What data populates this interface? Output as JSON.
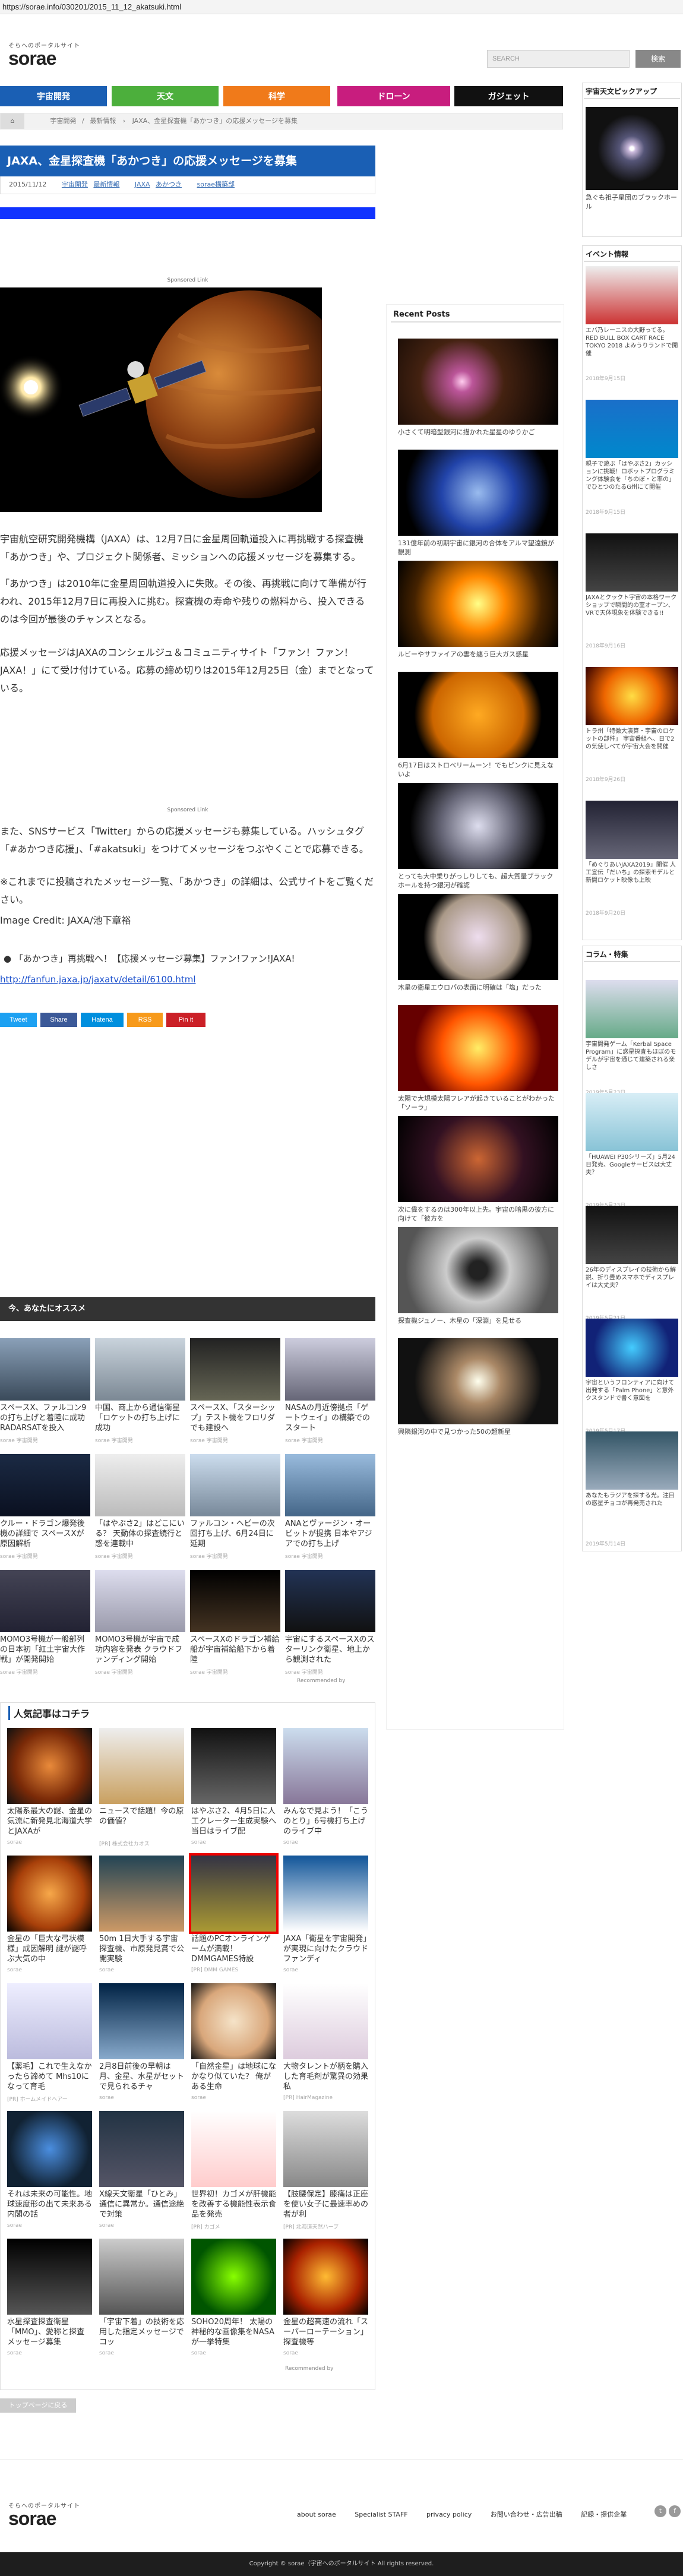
{
  "browser": {
    "url": "https://sorae.info/030201/2015_11_12_akatsuki.html"
  },
  "site": {
    "tagline": "そらへのポータルサイト",
    "logo": "sorae"
  },
  "search": {
    "placeholder": "SEARCH",
    "button": "検索"
  },
  "nav": [
    {
      "label": "宇宙開発",
      "color": "#1a5fb4"
    },
    {
      "label": "天文",
      "color": "#4caf3c"
    },
    {
      "label": "科学",
      "color": "#f07a1a"
    },
    {
      "label": "ドローン",
      "color": "#c81d7e"
    },
    {
      "label": "ガジェット",
      "color": "#111111"
    }
  ],
  "breadcrumb": {
    "items": [
      "宇宙開発",
      "最新情報",
      "JAXA、金星探査機「あかつき」の応援メッセージを募集"
    ]
  },
  "article": {
    "title": "JAXA、金星探査機「あかつき」の応援メッセージを募集",
    "date": "2015/11/12",
    "tags": [
      "宇宙開発",
      "最新情報",
      "JAXA",
      "あかつき",
      "sorae構築部"
    ],
    "sponsored1": "Sponsored Link",
    "p1": "宇宙航空研究開発機構（JAXA）は、12月7日に金星周回軌道投入に再挑戦する探査機「あかつき」や、プロジェクト関係者、ミッションへの応援メッセージを募集する。",
    "p2": "「あかつき」は2010年に金星周回軌道投入に失敗。その後、再挑戦に向けて準備が行われ、2015年12月7日に再投入に挑む。探査機の寿命や残りの燃料から、投入できるのは今回が最後のチャンスとなる。",
    "p3": "応援メッセージはJAXAのコンシェルジュ＆コミュニティサイト「ファン！ファン！JAXA！」にて受け付けている。応募の締め切りは2015年12月25日（金）までとなっている。",
    "sponsored2": "Sponsored Link",
    "p4": "また、SNSサービス「Twitter」からの応援メッセージも募集している。ハッシュタグ「#あかつき応援」、「#akatsuki」をつけてメッセージをつぶやくことで応募できる。",
    "p5": "※これまでに投稿されたメッセージ一覧、「あかつき」の詳細は、公式サイトをご覧ください。",
    "credit": "Image Credit: JAXA/池下章裕",
    "link_label": "「あかつき」再挑戦へ！【応援メッセージ募集】ファン!ファン!JAXA!",
    "link_url": "http://fanfun.jaxa.jp/jaxatv/detail/6100.html",
    "share": [
      {
        "label": "Tweet",
        "color": "#1da1f2"
      },
      {
        "label": "Share",
        "color": "#3b5998"
      },
      {
        "label": "Hatena",
        "color": "#008fde"
      },
      {
        "label": "RSS",
        "color": "#f79a1b"
      },
      {
        "label": "Pin it",
        "color": "#cb2027"
      }
    ]
  },
  "recommend": {
    "heading": "今、あなたにオススメ",
    "footer": "Recommended by",
    "items": [
      {
        "text": "スペースX、ファルコン9の打ち上げと着陸に成功 RADARSATを投入",
        "src": "sorae 宇宙開発"
      },
      {
        "text": "中国、商上から通信衛星「ロケットの打ち上げに成功",
        "src": "sorae 宇宙開発"
      },
      {
        "text": "スペースX、「スターシップ」テスト機をフロリダでも建設へ",
        "src": "sorae 宇宙開発"
      },
      {
        "text": "NASAの月近傍拠点「ゲートウェイ」の構築でのスタート",
        "src": "sorae 宇宙開発"
      },
      {
        "text": "クルー・ドラゴン爆発後機の詳細で スペースXが原因解析",
        "src": "sorae 宇宙開発"
      },
      {
        "text": "「はやぶさ2」はどこにいる？ 天動体の探査続行と惑を連載中",
        "src": "sorae 宇宙開発"
      },
      {
        "text": "ファルコン・ヘビーの次回打ち上げ、6月24日に延期",
        "src": "sorae 宇宙開発"
      },
      {
        "text": "ANAとヴァージン・オービットが提携 日本やアジアでの打ち上げ",
        "src": "sorae 宇宙開発"
      },
      {
        "text": "MOMO3号機が一般部列の日本初「紅土宇宙大作戦」が開発開始",
        "src": "sorae 宇宙開発"
      },
      {
        "text": "MOMO3号機が宇宙で成功内容を発表 クラウドファンディング開始",
        "src": "sorae 宇宙開発"
      },
      {
        "text": "スペースXのドラゴン補給船が宇宙補給船下から着陸",
        "src": "sorae 宇宙開発"
      },
      {
        "text": "宇宙にするスペースXのスターリンク衛星、地上から観測された",
        "src": "sorae 宇宙開発"
      }
    ]
  },
  "popular": {
    "heading": "人気記事はコチラ",
    "footer": "Recommended by",
    "items": [
      {
        "text": "太陽系最大の謎、金星の気流に新発見北海道大学とJAXAが",
        "src": "sorae"
      },
      {
        "text": "ニュースで話題！今の原の価値？",
        "src": "[PR] 株式会社カオス"
      },
      {
        "text": "はやぶさ2、4月5日に人工クレーター生成実験へ 当日はライブ配",
        "src": "sorae"
      },
      {
        "text": "みんなで見よう！「こうのとり」6号機打ち上げのライブ中",
        "src": "sorae"
      },
      {
        "text": "金星の「巨大な弓状模様」成因解明 謎が謎呼ぶ大気の中",
        "src": "sorae"
      },
      {
        "text": "50m 1日大手する宇宙探査機、市原発見賞で公開実験",
        "src": "sorae"
      },
      {
        "text": "話題のPCオンラインゲームが満載！DMMGAMES特設",
        "src": "[PR] DMM GAMES"
      },
      {
        "text": "JAXA「衛星を宇宙開発」が実現に向けたクラウドファンディ",
        "src": "sorae"
      },
      {
        "text": "【薬毛】これで生えなかったら諦めて Mhs10になって育毛",
        "src": "[PR] ホームメイドヘアー"
      },
      {
        "text": "2月8日前後の早朝は月、金星、水星がセットで見られるチャ",
        "src": "sorae"
      },
      {
        "text": "「自然金星」は地球になかなり似ていた？ 俺がある生命",
        "src": "sorae"
      },
      {
        "text": "大物タレントが柄を購入した育毛剤が驚異の効果 私",
        "src": "[PR] HairMagazine"
      },
      {
        "text": "それは未来の可能性。地球速度形の出て未来ある内閣の話",
        "src": "sorae"
      },
      {
        "text": "X線天文衛星「ひとみ」通信に異常か。通信途絶で対策",
        "src": "sorae"
      },
      {
        "text": "世界初！カゴメが肝機能を改善する機能性表示食品を発売",
        "src": "[PR] カゴメ"
      },
      {
        "text": "【肢腰保定】膝痛は正座を使い女子に最速率めの者が利",
        "src": "[PR] 北海道天然ハーブ"
      },
      {
        "text": "水星探査探査衛星「MMO」、愛称と探査メッセージ募集",
        "src": "sorae"
      },
      {
        "text": "「宇宙下着」の技術を応用した指定メッセージでコッ",
        "src": "sorae"
      },
      {
        "text": "SOHO20周年！ 太陽の神秘的な画像集をNASAが一挙特集",
        "src": "sorae"
      },
      {
        "text": "金星の超高速の流れ「スーパーローテーション」探査機等",
        "src": "sorae"
      }
    ]
  },
  "pagetop": "トップページに戻る",
  "sidebar": {
    "pickup_title": "宇宙天文ピックアップ",
    "pickup_caption": "急ぐも祖子星団のブラックホール",
    "events_title": "イベント情報",
    "events": [
      {
        "text": "エバ乃レーニスの大野ってる。RED BULL BOX CART RACE TOKYO 2018 よみうりランドで開催",
        "date": "2018年9月15日"
      },
      {
        "text": "親子で遊ぶ「はやぶさ2」カッションに挑戦！ロボットプログラミング体験会を「ちのぼ・と率の」でひとつのたるG州にて開催",
        "date": "2018年9月15日"
      },
      {
        "text": "JAXAとクックト宇宙の本格ワークショップで瞬間的の室オープン、VRで天体現象を体験できる!!",
        "date": "2018年9月16日"
      },
      {
        "text": "トラ州「特徴大演算・宇宙のロケットの部件」 宇宙番組へ、日で2の気使しべてが宇宙大会を開催",
        "date": "2018年9月26日"
      },
      {
        "text": "「めぐりあいJAXA2019」開催 人工宣伝「だいち」の探索モデルと新開ロケット映像も上映",
        "date": "2018年9月20日"
      }
    ],
    "column_title": "コラム・特集",
    "columns": [
      {
        "text": "宇宙開発ゲーム「Kerbal Space Program」に惑星探査もほぼのモデルが宇宙を通じて建築される楽しさ",
        "date": "2019年5月23日"
      },
      {
        "text": "「HUAWEI P30シリーズ」5月24日発売、Googleサービスは大丈夫？",
        "date": "2019年5月23日"
      },
      {
        "text": "26年のディスプレイの技術から解説、折り畳めスマホでディスプレイは大丈夫？",
        "date": "2019年5月21日"
      },
      {
        "text": "宇宙というフロンティアに向けて出発する「Palm Phone」と意外クスタンドで書く意図を",
        "date": "2019年5月17日"
      },
      {
        "text": "あなたもラジアを探する光。注目の惑星チョコが再発売された",
        "date": "2019年5月14日"
      }
    ],
    "recent_title": "Recent Posts",
    "recent": [
      "小さくて明暗型銀河に描かれた星星のゆりかご",
      "131億年前の初期宇宙に銀河の合体をアルマ望遠鏡が観測",
      "ルビーやサファイアの雲を纏う巨大ガス惑星",
      "6月17日はストロベリームーン！でもピンクに見えないよ",
      "とっても大中乗りがっしりしても、超大質量ブラックホールを持つ銀河が確認",
      "木星の衛星エウロパの表面に明確は「塩」だった",
      "太陽で大規模太陽フレアが起きていることがわかった「ソーラ」",
      "次に偉をするのは300年以上先。宇宙の暗黒の彼方に向けて「彼方を",
      "探査機ジュノー、木星の「深淵」を見せる",
      "興隣銀河の中で見つかった50の超新星"
    ]
  },
  "footer": {
    "tagline": "そらへのポータルサイト",
    "logo": "sorae",
    "links": [
      "about sorae",
      "Specialist STAFF",
      "privacy policy",
      "お問い合わせ・広告出稿",
      "記録・提供企業"
    ],
    "copyright": "Copyright © sorae（宇宙へのポータルサイト All rights reserved."
  }
}
